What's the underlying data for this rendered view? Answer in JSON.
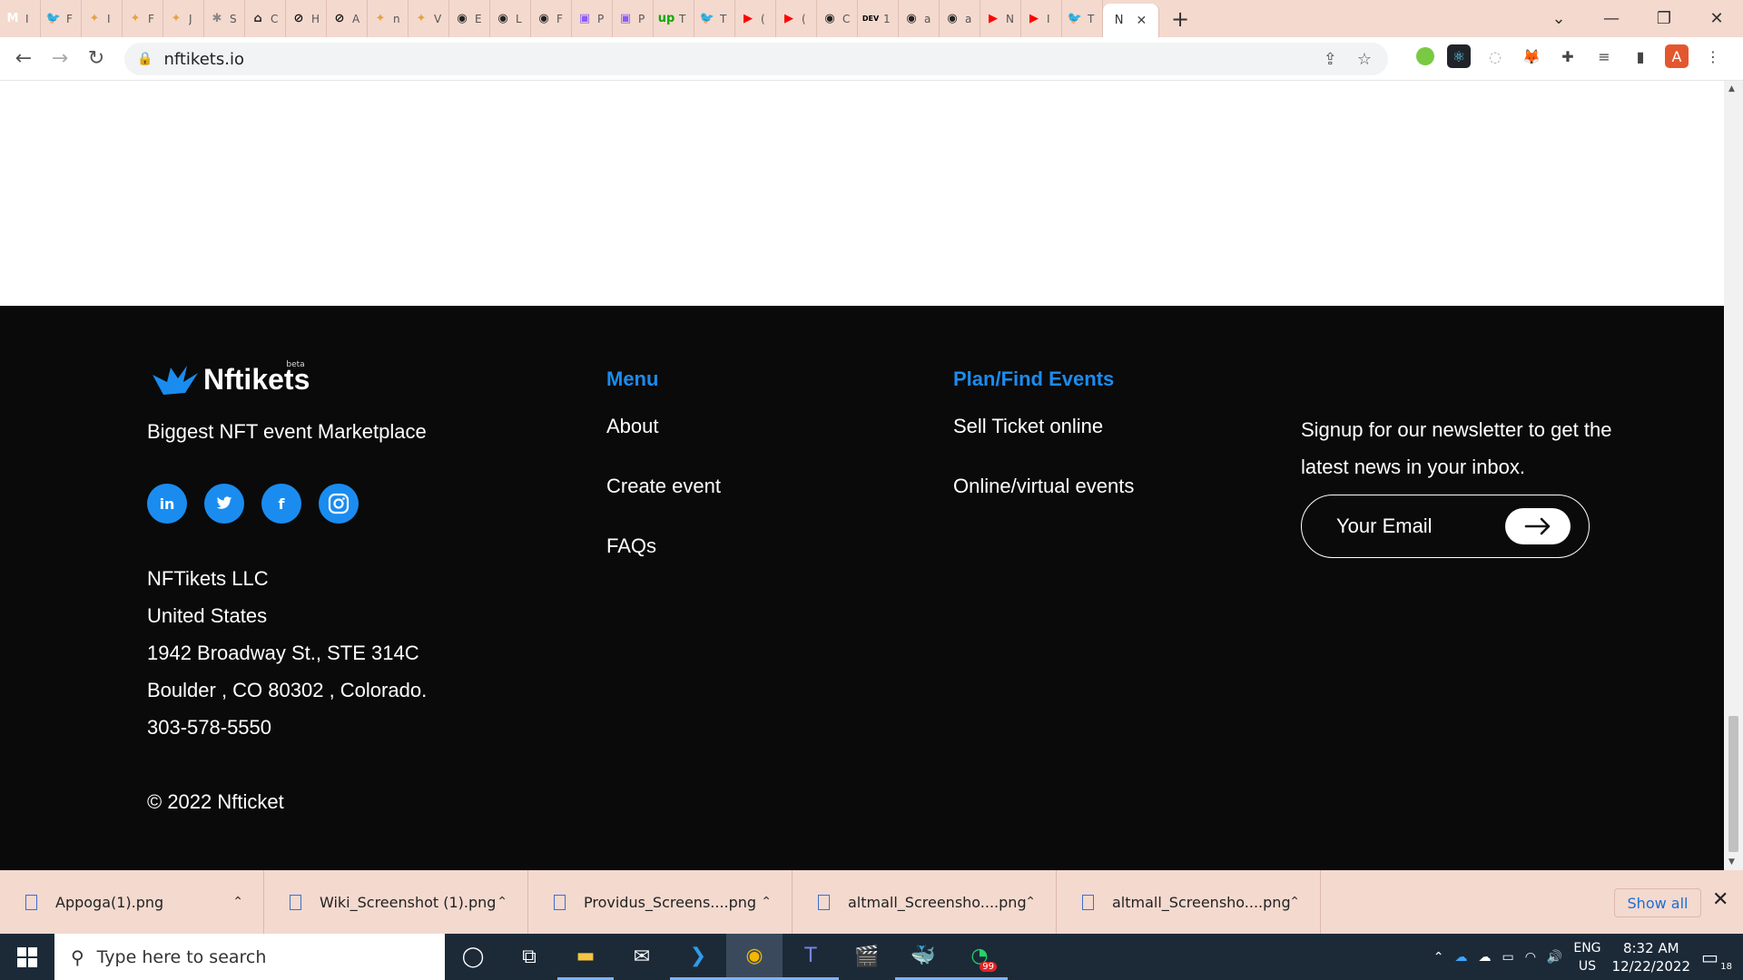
{
  "browser": {
    "tabs": [
      {
        "icon": "gmail-icon",
        "color": "#ffffff",
        "glyph": "M",
        "label": "I"
      },
      {
        "icon": "twitter-icon",
        "color": "#1d9bf0",
        "glyph": "🐦",
        "label": "F"
      },
      {
        "icon": "bird-logo-icon",
        "color": "#e8a23c",
        "glyph": "✦",
        "label": "I"
      },
      {
        "icon": "bird-logo-icon",
        "color": "#e8a23c",
        "glyph": "✦",
        "label": "F"
      },
      {
        "icon": "bird-logo-icon",
        "color": "#e8a23c",
        "glyph": "✦",
        "label": "J"
      },
      {
        "icon": "settings-icon",
        "color": "#888888",
        "glyph": "✱",
        "label": "S"
      },
      {
        "icon": "home-icon",
        "color": "#222222",
        "glyph": "⌂",
        "label": "C"
      },
      {
        "icon": "circle-logo-icon",
        "color": "#111111",
        "glyph": "⊘",
        "label": "H"
      },
      {
        "icon": "circle-logo-icon",
        "color": "#111111",
        "glyph": "⊘",
        "label": "A"
      },
      {
        "icon": "bird-logo-icon",
        "color": "#e8a23c",
        "glyph": "✦",
        "label": "n"
      },
      {
        "icon": "bird-logo-icon",
        "color": "#e8a23c",
        "glyph": "✦",
        "label": "V"
      },
      {
        "icon": "github-icon",
        "color": "#222222",
        "glyph": "◉",
        "label": "E"
      },
      {
        "icon": "github-icon",
        "color": "#222222",
        "glyph": "◉",
        "label": "L"
      },
      {
        "icon": "github-icon",
        "color": "#222222",
        "glyph": "◉",
        "label": "F"
      },
      {
        "icon": "purple-app-icon",
        "color": "#8a5cf6",
        "glyph": "▣",
        "label": "P"
      },
      {
        "icon": "purple-app-icon",
        "color": "#8a5cf6",
        "glyph": "▣",
        "label": "P"
      },
      {
        "icon": "upwork-icon",
        "color": "#14a800",
        "glyph": "up",
        "label": "T"
      },
      {
        "icon": "twitter-icon",
        "color": "#1d9bf0",
        "glyph": "🐦",
        "label": "T"
      },
      {
        "icon": "youtube-icon",
        "color": "#ff0000",
        "glyph": "▶",
        "label": "("
      },
      {
        "icon": "youtube-icon",
        "color": "#ff0000",
        "glyph": "▶",
        "label": "("
      },
      {
        "icon": "github-icon",
        "color": "#222222",
        "glyph": "◉",
        "label": "C"
      },
      {
        "icon": "dev-icon",
        "color": "#000000",
        "glyph": "DEV",
        "label": "1"
      },
      {
        "icon": "github-icon",
        "color": "#222222",
        "glyph": "◉",
        "label": "a"
      },
      {
        "icon": "github-icon",
        "color": "#222222",
        "glyph": "◉",
        "label": "a"
      },
      {
        "icon": "youtube-icon",
        "color": "#ff0000",
        "glyph": "▶",
        "label": "N"
      },
      {
        "icon": "youtube-icon",
        "color": "#ff0000",
        "glyph": "▶",
        "label": "I"
      },
      {
        "icon": "twitter-icon",
        "color": "#1d9bf0",
        "glyph": "🐦",
        "label": "T"
      }
    ],
    "active_tab_label": "N",
    "url": "nftikets.io"
  },
  "footer": {
    "brand_name": "Nftikets",
    "brand_beta": "beta",
    "tagline": "Biggest NFT event Marketplace",
    "socials": [
      {
        "name": "linkedin-icon",
        "glyph": "in"
      },
      {
        "name": "twitter-icon",
        "glyph": "🐦"
      },
      {
        "name": "facebook-icon",
        "glyph": "f"
      },
      {
        "name": "instagram-icon",
        "glyph": "◎"
      }
    ],
    "address": {
      "company": "NFTikets LLC",
      "country": "United States",
      "street": "1942 Broadway St., STE 314C",
      "city": "Boulder , CO 80302 , Colorado.",
      "phone": "303-578-5550"
    },
    "copyright": "© 2022 Nfticket",
    "menu": {
      "heading": "Menu",
      "links": [
        "About",
        "Create event",
        "FAQs"
      ]
    },
    "events": {
      "heading": "Plan/Find Events",
      "links": [
        "Sell Ticket online",
        "Online/virtual events"
      ]
    },
    "newsletter": {
      "text": "Signup for our newsletter to get the latest news in your inbox.",
      "placeholder": "Your Email"
    }
  },
  "downloads": {
    "items": [
      "Appoga(1).png",
      "Wiki_Screenshot (1).png",
      "Providus_Screens....png",
      "altmall_Screensho....png",
      "altmall_Screensho....png"
    ],
    "show_all": "Show all"
  },
  "taskbar": {
    "search_placeholder": "Type here to search",
    "lang_top": "ENG",
    "lang_bottom": "US",
    "time": "8:32 AM",
    "date": "12/22/2022",
    "notifications": "18",
    "whatsapp_badge": "99"
  },
  "colors": {
    "accent": "#1a8cf0",
    "footer_bg": "#0a0a0a",
    "browser_frame": "#f4d9cf"
  }
}
